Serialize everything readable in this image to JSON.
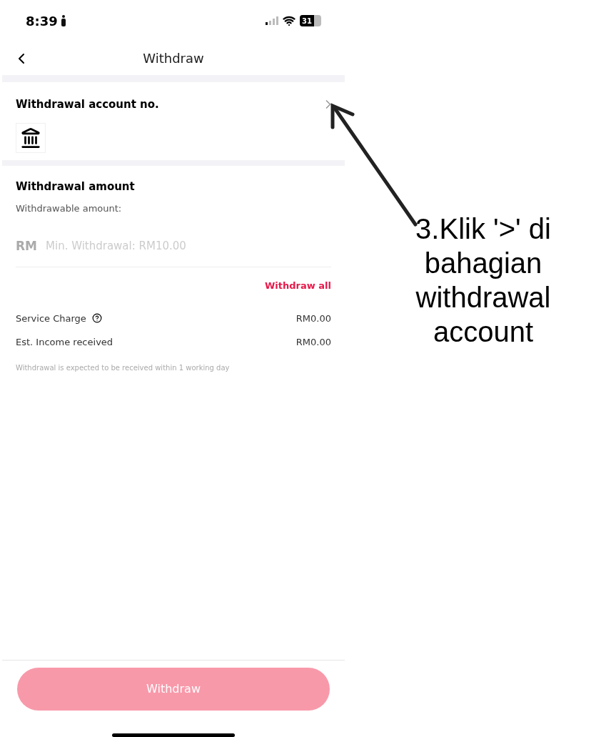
{
  "status_bar": {
    "time": "8:39",
    "battery": "31"
  },
  "header": {
    "title": "Withdraw"
  },
  "account": {
    "title": "Withdrawal account no."
  },
  "amount": {
    "title": "Withdrawal amount",
    "withdrawable_label": "Withdrawable amount:",
    "currency": "RM",
    "placeholder": "Min. Withdrawal: RM10.00",
    "withdraw_all": "Withdraw all"
  },
  "fees": [
    {
      "label": "Service Charge",
      "value": "RM0.00",
      "help": true
    },
    {
      "label": "Est. Income received",
      "value": "RM0.00",
      "help": false
    }
  ],
  "note": "Withdrawal is expected to be received within 1 working day",
  "button": {
    "label": "Withdraw",
    "disabled": true
  },
  "annotation": {
    "lines": [
      "3.Klik '>' di",
      "bahagian",
      "withdrawal",
      "account"
    ]
  }
}
